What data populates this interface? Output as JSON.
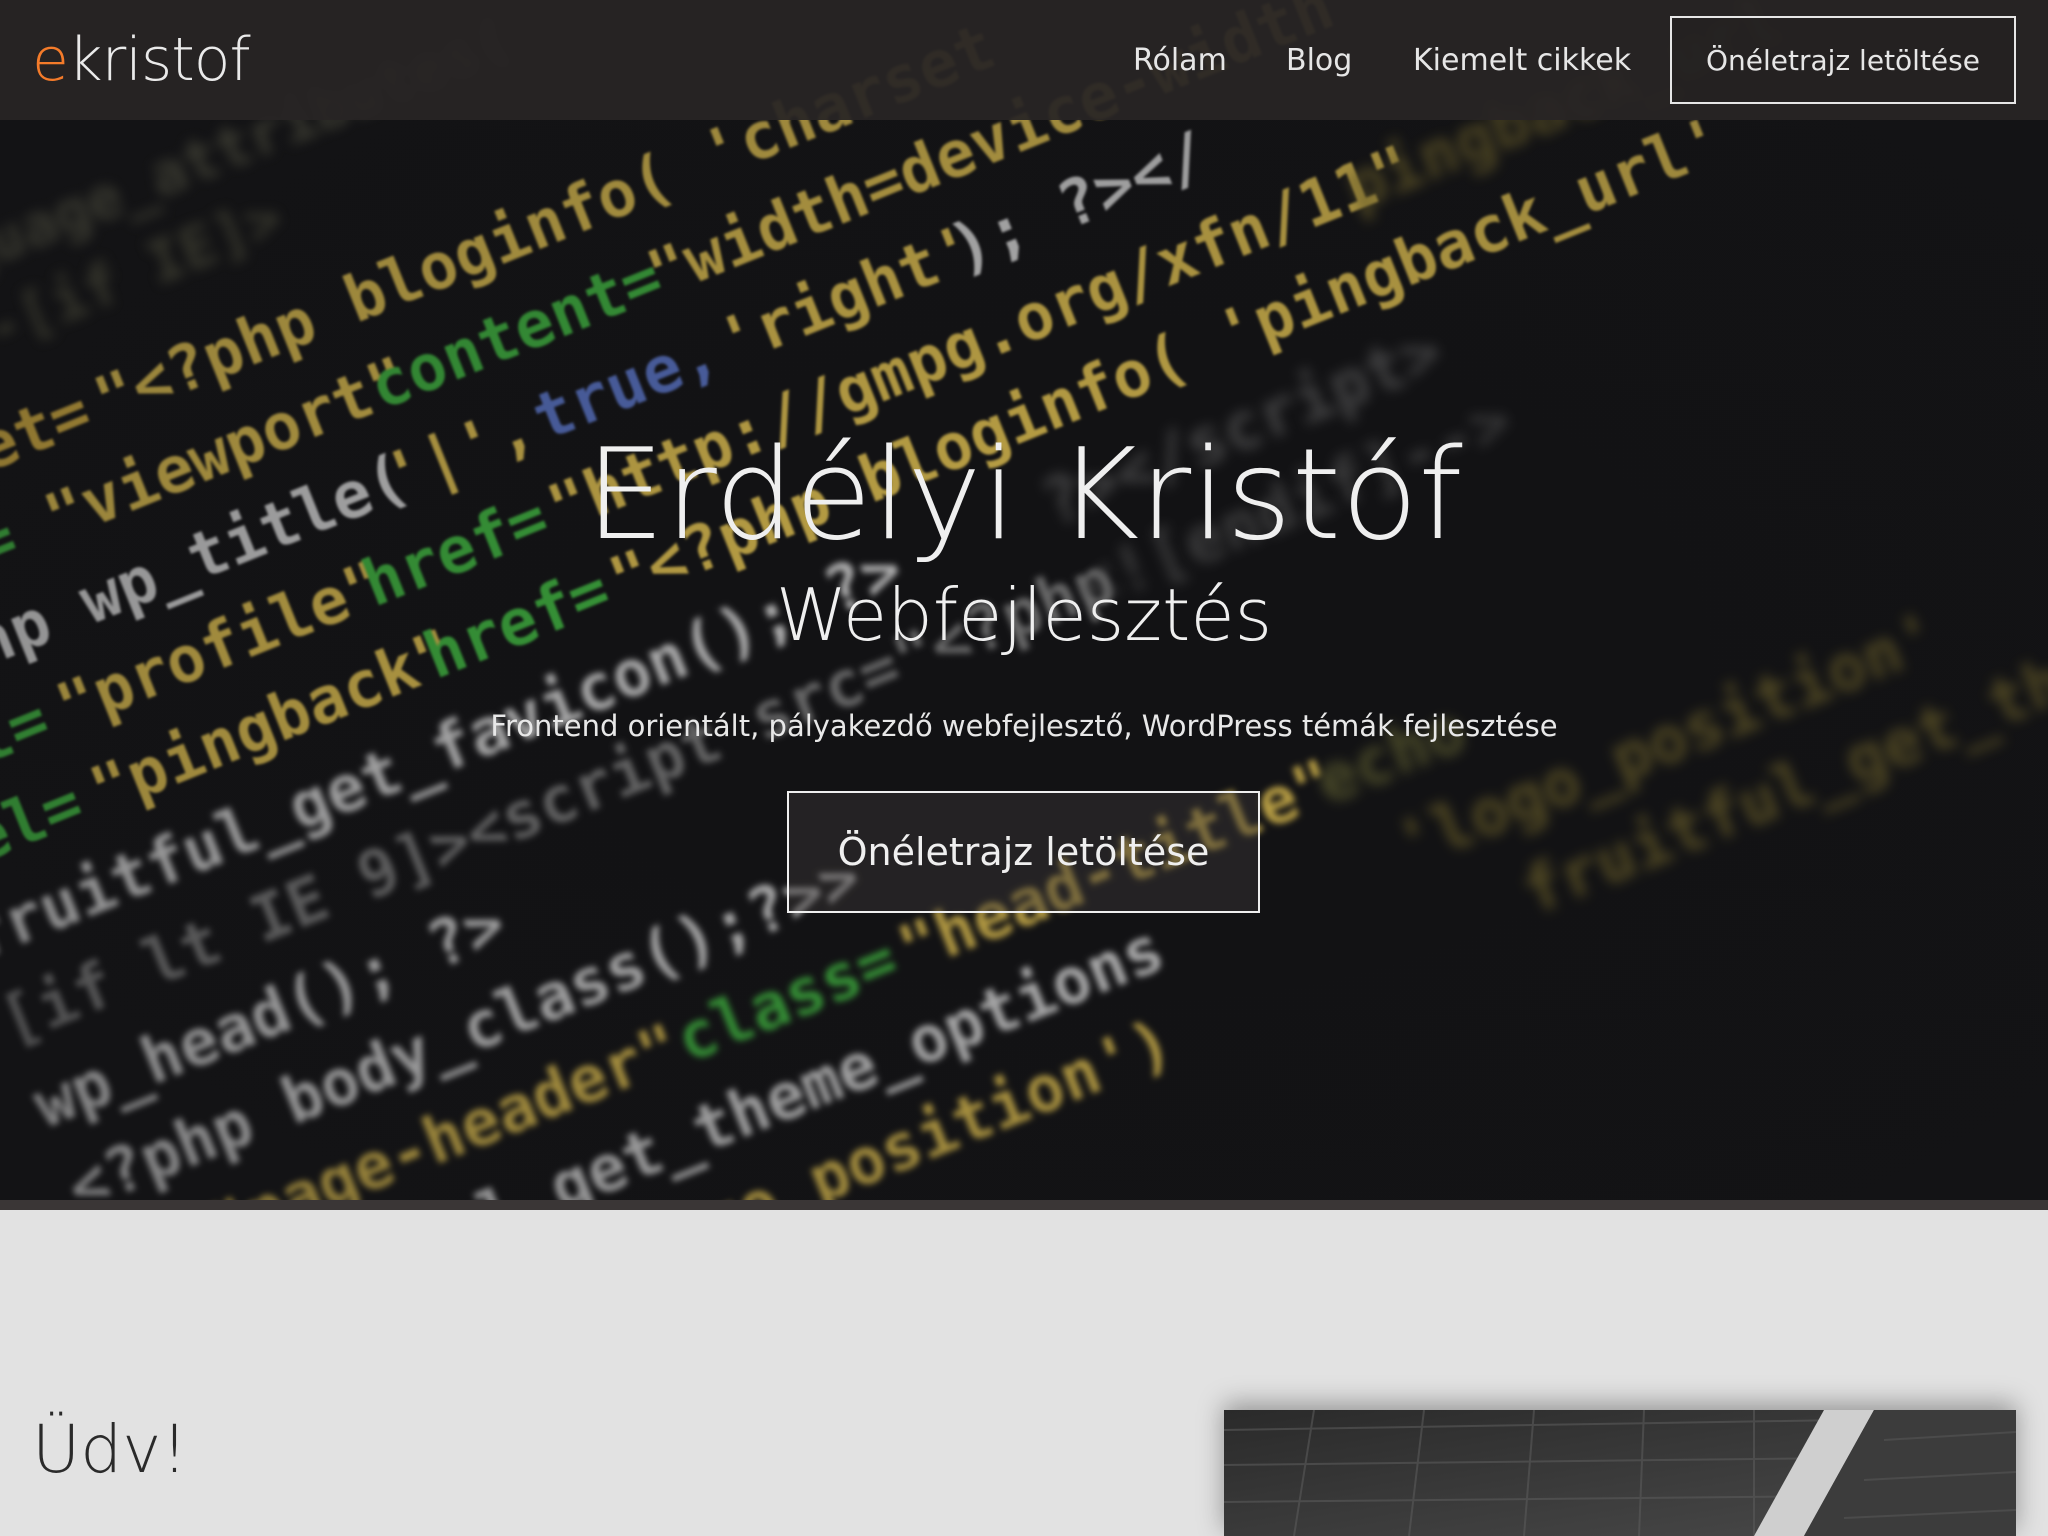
{
  "navbar": {
    "brand_accent": "e",
    "brand_rest": "kristof",
    "links": [
      {
        "label": "Rólam"
      },
      {
        "label": "Blog"
      },
      {
        "label": "Kiemelt cikkek"
      }
    ],
    "cv_button": "Önéletrajz letöltése"
  },
  "hero": {
    "title": "Erdélyi Kristóf",
    "subtitle": "Webfejlesztés",
    "description": "Frontend orientált, pályakezdő webfejlesztő, WordPress témák fejlesztése",
    "cv_button": "Önéletrajz letöltése"
  },
  "about": {
    "title": "Üdv!"
  },
  "colors": {
    "accent": "#f47b2a",
    "navbar_bg": "#282525",
    "page_bg": "#e2e2e2"
  }
}
